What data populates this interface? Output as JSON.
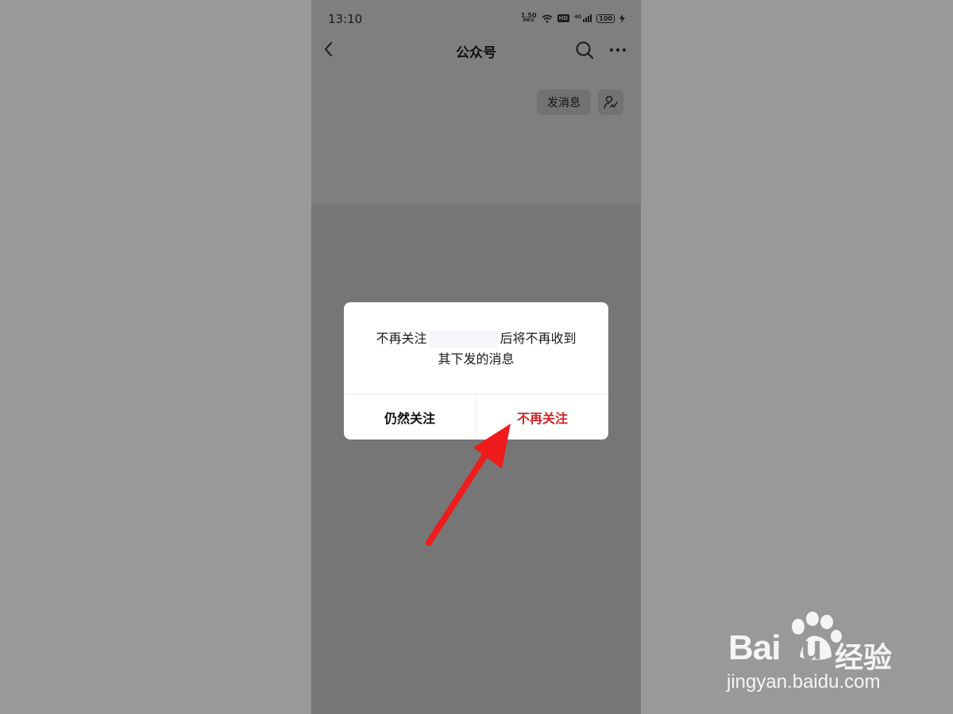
{
  "status_bar": {
    "time": "13:10",
    "net_speed_value": "1.50",
    "net_speed_unit": "MB/S",
    "hd_label": "HD",
    "signal_label": "4G",
    "battery": "100"
  },
  "nav": {
    "title": "公众号"
  },
  "actions": {
    "send_message": "发消息"
  },
  "dialog": {
    "message_before": "不再关注",
    "message_after": "后将不再收到",
    "message_line2": "其下发的消息",
    "keep_label": "仍然关注",
    "unfollow_label": "不再关注",
    "unfollow_color": "#d42222"
  },
  "watermark": {
    "brand_a": "Bai",
    "brand_b": "du",
    "brand_cn": "经验",
    "url": "jingyan.baidu.com"
  },
  "annotation": {
    "arrow_color": "#ee1c1c"
  }
}
